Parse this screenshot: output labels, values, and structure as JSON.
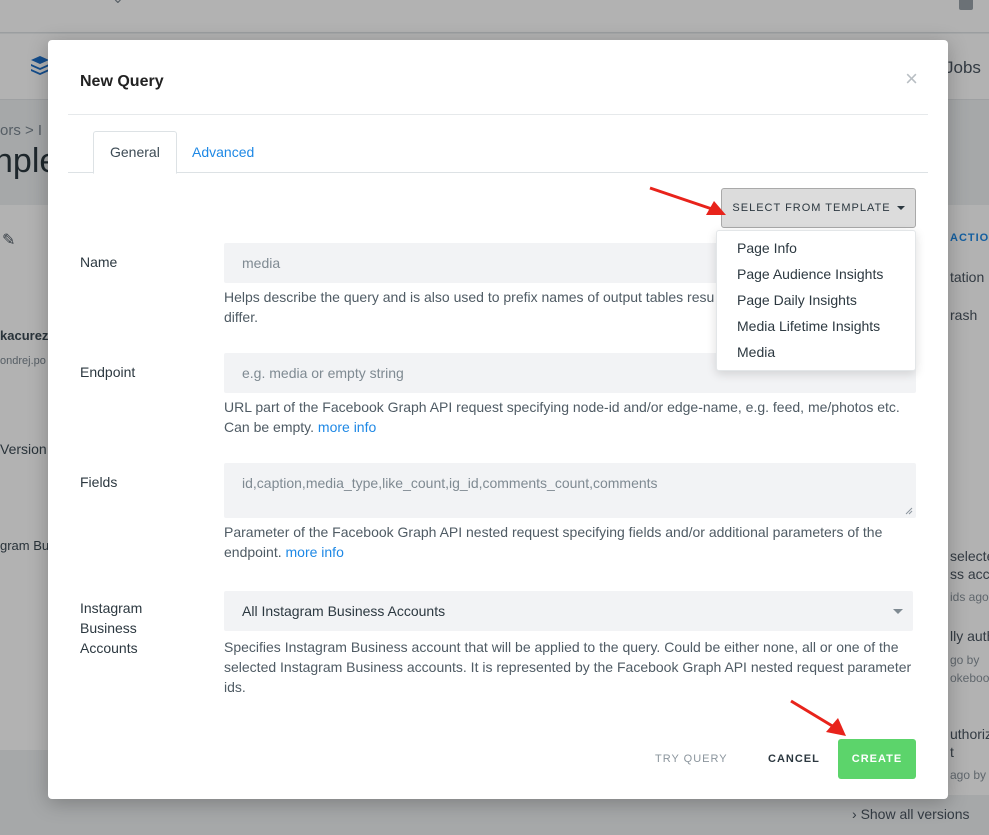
{
  "background": {
    "nav_jobs": "Jobs",
    "breadcrumb": "ors > I",
    "heading": "nple",
    "left_texts": [
      "kacurez",
      "ondrej.po",
      "Version",
      "gram Bus"
    ],
    "right_action": "ACTION",
    "right_texts": [
      "tation",
      "rash",
      "selecte",
      "ss acc",
      "ids ago",
      "lly auth",
      "go by",
      "okebool",
      "uthoriz",
      "t",
      "ago by"
    ],
    "show_all": "Show all versions"
  },
  "modal": {
    "title": "New Query",
    "close_icon": "close-icon",
    "tabs": [
      {
        "label": "General",
        "active": true
      },
      {
        "label": "Advanced",
        "active": false
      }
    ],
    "template_button": "SELECT FROM TEMPLATE",
    "template_options": [
      "Page Info",
      "Page Audience Insights",
      "Page Daily Insights",
      "Media Lifetime Insights",
      "Media"
    ],
    "fields": {
      "name": {
        "label": "Name",
        "value": "media",
        "help": "Helps describe the query and is also used to prefix names of output tables resul",
        "help_line2": "differ."
      },
      "endpoint": {
        "label": "Endpoint",
        "placeholder": "e.g. media or empty string",
        "help": "URL part of the Facebook Graph API request specifying node-id and/or edge-name, e.g. feed, me/photos etc. Can be empty.",
        "help_link": "more info"
      },
      "fields": {
        "label": "Fields",
        "value": "id,caption,media_type,like_count,ig_id,comments_count,comments",
        "help": "Parameter of the Facebook Graph API nested request specifying fields and/or additional parameters of the endpoint.",
        "help_link": "more info"
      },
      "accounts": {
        "label_lines": [
          "Instagram",
          "Business",
          "Accounts"
        ],
        "selected": "All Instagram Business Accounts",
        "help": "Specifies Instagram Business account that will be applied to the query. Could be either none, all or one of the selected Instagram Business accounts. It is represented by the Facebook Graph API nested request parameter ids."
      }
    },
    "footer": {
      "try_query": "TRY QUERY",
      "cancel": "CANCEL",
      "create": "CREATE"
    }
  },
  "colors": {
    "accent_blue": "#1e88e5",
    "create_green": "#5cd46b",
    "annotation_red": "#e8231b"
  }
}
